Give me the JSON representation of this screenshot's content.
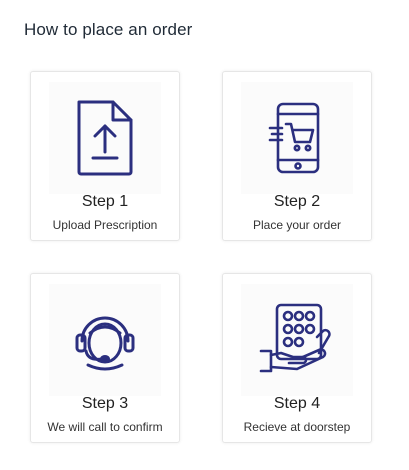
{
  "page": {
    "title": "How to place an order"
  },
  "theme": {
    "icon_color": "#2b2f7f",
    "card_border": "#e6e6e6"
  },
  "steps": [
    {
      "title": "Step 1",
      "subtitle": "Upload Prescription",
      "icon": "upload-document-icon"
    },
    {
      "title": "Step 2",
      "subtitle": "Place your order",
      "icon": "mobile-cart-icon"
    },
    {
      "title": "Step 3",
      "subtitle": "We will call to confirm",
      "icon": "support-headset-icon"
    },
    {
      "title": "Step 4",
      "subtitle": "Recieve at doorstep",
      "icon": "pills-in-hand-icon"
    }
  ]
}
